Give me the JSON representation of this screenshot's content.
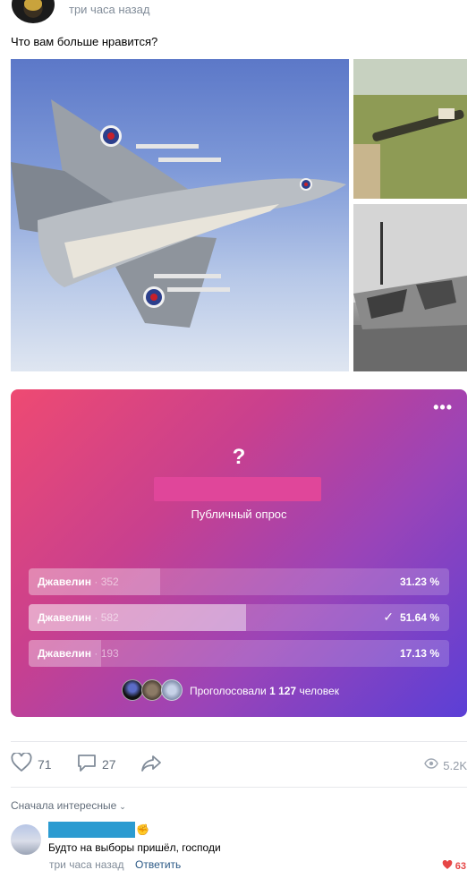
{
  "post": {
    "time": "три часа назад",
    "text": "Что вам больше нравится?"
  },
  "poll": {
    "question": "?",
    "type": "Публичный опрос",
    "options": [
      {
        "label": "Джавелин",
        "count": "· 352",
        "percent": "31.23 %",
        "share": 31.23,
        "chosen": false
      },
      {
        "label": "Джавелин",
        "count": "· 582",
        "percent": "51.64 %",
        "share": 51.64,
        "chosen": true
      },
      {
        "label": "Джавелин",
        "count": "· 193",
        "percent": "17.13 %",
        "share": 17.13,
        "chosen": false
      }
    ],
    "voters_prefix": "Проголосовали",
    "voters_count": "1 127",
    "voters_suffix": "человек"
  },
  "actions": {
    "likes": "71",
    "comments": "27",
    "views": "5.2K"
  },
  "comments": {
    "sort_label": "Сначала интересные",
    "items": [
      {
        "text": "Будто на выборы пришёл, господи",
        "time": "три часа назад",
        "reply_label": "Ответить",
        "likes": "63"
      }
    ]
  },
  "colors": {
    "accent_link": "#2a5885",
    "like_red": "#e64646",
    "poll_gradient_start": "#ee4a72",
    "poll_gradient_end": "#5b3fd6"
  },
  "icons": [
    "more-icon",
    "check-icon",
    "like-icon",
    "comment-icon",
    "share-icon",
    "views-icon",
    "chevron-down-icon",
    "heart-filled-icon"
  ]
}
